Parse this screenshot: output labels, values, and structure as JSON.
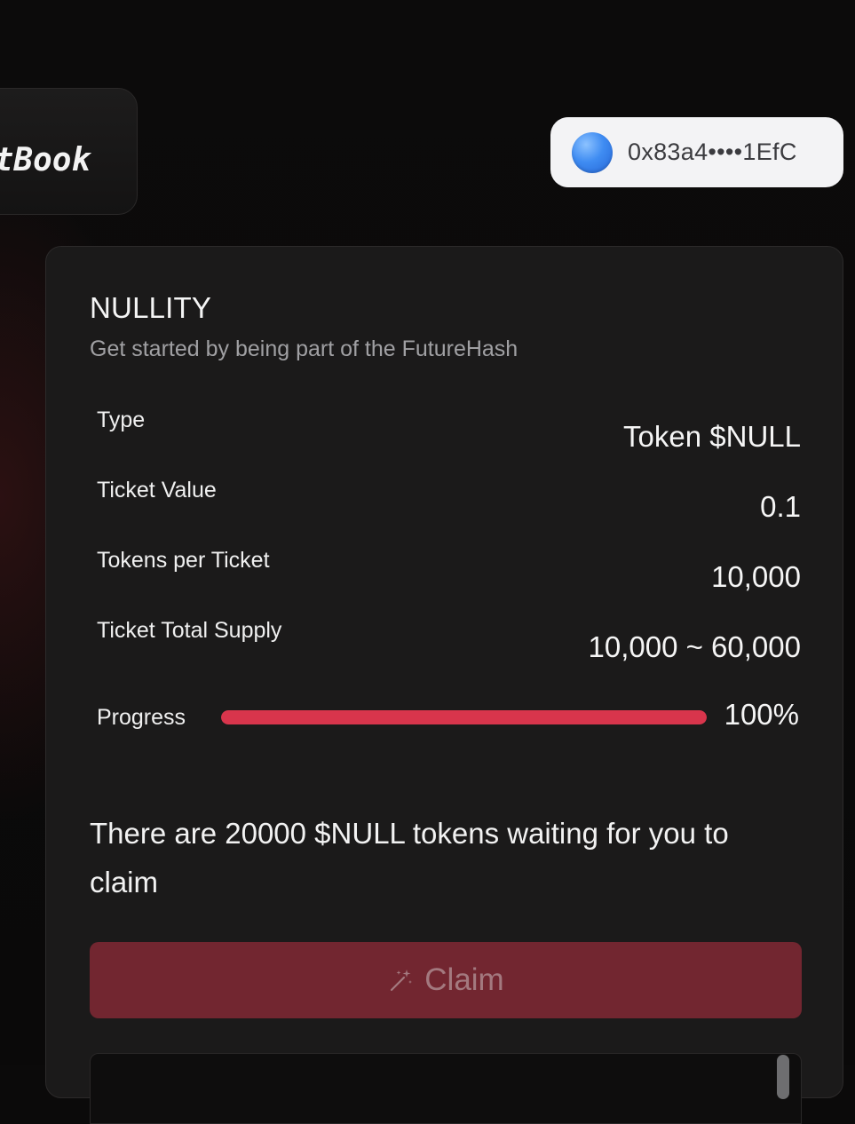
{
  "header": {
    "logo_text": "itBook",
    "wallet": {
      "address": "0x83a4••••1EfC",
      "avatar_icon": "blue-gradient-avatar-icon"
    }
  },
  "card": {
    "title": "NULLITY",
    "subtitle": "Get started by being part of the FutureHash",
    "rows": [
      {
        "label": "Type",
        "value": "Token $NULL"
      },
      {
        "label": "Ticket Value",
        "value": "0.1"
      },
      {
        "label": "Tokens per Ticket",
        "value": "10,000"
      },
      {
        "label": "Ticket Total Supply",
        "value": "10,000 ~ 60,000"
      }
    ],
    "progress": {
      "label": "Progress",
      "value_text": "100%",
      "fraction": 1.0,
      "color": "#d8354c"
    },
    "claim_message": "There are 20000 $NULL tokens waiting for you to claim",
    "claim_button": {
      "label": "Claim",
      "icon": "magic-wand-icon",
      "color": "#722630"
    }
  }
}
